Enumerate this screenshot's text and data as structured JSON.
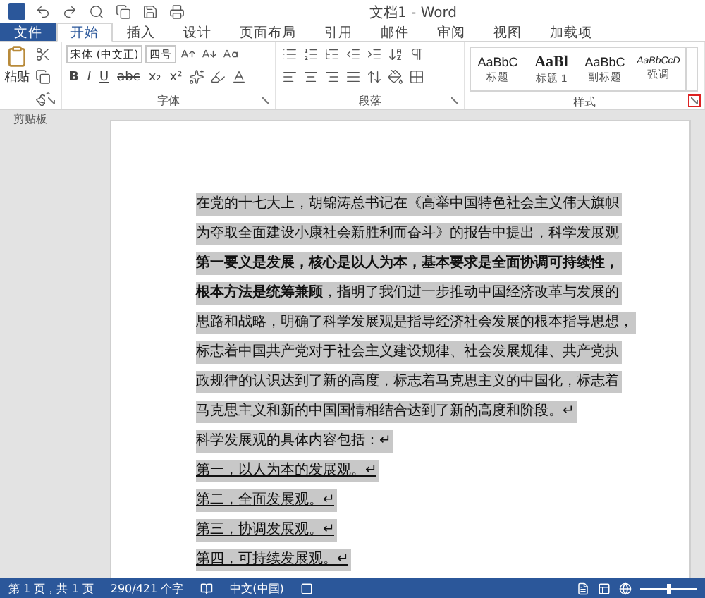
{
  "title_bar": {
    "title": "文档1 - Word"
  },
  "tabs": [
    {
      "label": "文件",
      "kind": "file",
      "selected": false
    },
    {
      "label": "开始",
      "kind": "tab",
      "selected": true
    },
    {
      "label": "插入",
      "kind": "tab",
      "selected": false
    },
    {
      "label": "设计",
      "kind": "tab",
      "selected": false
    },
    {
      "label": "页面布局",
      "kind": "tab",
      "selected": false
    },
    {
      "label": "引用",
      "kind": "tab",
      "selected": false
    },
    {
      "label": "邮件",
      "kind": "tab",
      "selected": false
    },
    {
      "label": "审阅",
      "kind": "tab",
      "selected": false
    },
    {
      "label": "视图",
      "kind": "tab",
      "selected": false
    },
    {
      "label": "加载项",
      "kind": "tab",
      "selected": false
    }
  ],
  "ribbon": {
    "clipboard": {
      "paste_label": "粘贴",
      "group_label": "剪贴板"
    },
    "font": {
      "font_name": "宋体 (中文正)",
      "font_size": "四号",
      "format_buttons": [
        "B",
        "I",
        "U",
        "abc",
        "x₂",
        "x²"
      ],
      "group_label": "字体"
    },
    "paragraph": {
      "group_label": "段落"
    },
    "styles": {
      "items": [
        {
          "sample": "AaBbC",
          "label": "标题",
          "kind": "heading"
        },
        {
          "sample": "AaBl",
          "label": "标题 1",
          "kind": "heading1"
        },
        {
          "sample": "AaBbC",
          "label": "副标题",
          "kind": "subtitle"
        },
        {
          "sample": "AaBbCcD",
          "label": "强调",
          "kind": "emphasis"
        }
      ],
      "group_label": "样式",
      "launcher_highlighted": true
    }
  },
  "document": {
    "lines": [
      {
        "text": "在党的十七大上，胡锦涛总书记在《高举中国特色社会主义伟大旗帜",
        "bold": false,
        "underline": false
      },
      {
        "text": "为夺取全面建设小康社会新胜利而奋斗》的报告中提出，科学发展观",
        "bold": false,
        "underline": false
      },
      {
        "text": "第一要义是发展，核心是以人为本，基本要求是全面协调可持续性，",
        "bold": true,
        "underline": false
      },
      {
        "text": "**根本方法是统筹兼顾**，指明了我们进一步推动中国经济改革与发展的",
        "bold": false,
        "underline": false
      },
      {
        "text": "思路和战略，明确了科学发展观是指导经济社会发展的根本指导思想，",
        "bold": false,
        "underline": false
      },
      {
        "text": "标志着中国共产党对于社会主义建设规律、社会发展规律、共产党执",
        "bold": false,
        "underline": false
      },
      {
        "text": "政规律的认识达到了新的高度，标志着马克思主义的中国化，标志着",
        "bold": false,
        "underline": false
      },
      {
        "text": "马克思主义和新的中国国情相结合达到了新的高度和阶段。↵",
        "bold": false,
        "underline": false
      },
      {
        "text": "科学发展观的具体内容包括：↵",
        "bold": false,
        "underline": false
      },
      {
        "text": "第一，以人为本的发展观。↵",
        "bold": false,
        "underline": true
      },
      {
        "text": "第二，全面发展观。↵",
        "bold": false,
        "underline": true
      },
      {
        "text": "第三，协调发展观。↵",
        "bold": false,
        "underline": true
      },
      {
        "text": "第四，可持续发展观。↵",
        "bold": false,
        "underline": true
      }
    ]
  },
  "status_bar": {
    "page": "第 1 页，共 1 页",
    "words": "290/421 个字",
    "language": "中文(中国)",
    "zoom": {
      "level": 0.5
    }
  }
}
